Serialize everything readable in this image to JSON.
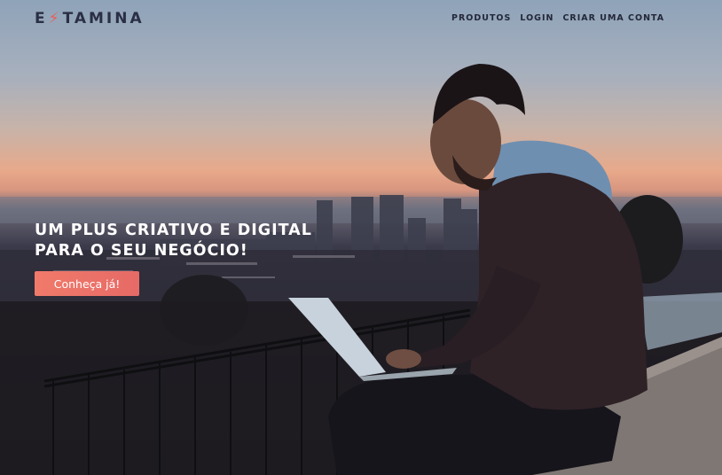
{
  "header": {
    "logo_prefix": "E",
    "logo_suffix": "TAMINA",
    "nav": [
      {
        "label": "PRODUTOS"
      },
      {
        "label": "LOGIN"
      },
      {
        "label": "CRIAR UMA CONTA"
      }
    ]
  },
  "hero": {
    "headline_line1": "UM PLUS CRIATIVO E DIGITAL",
    "headline_line2": "PARA O SEU NEGÓCIO!",
    "cta_label": "Conheça já!"
  },
  "colors": {
    "accent": "#e8605a",
    "logo_text": "#2a2f45",
    "nav_text": "#23283a",
    "cta_background": "#ee7468"
  }
}
